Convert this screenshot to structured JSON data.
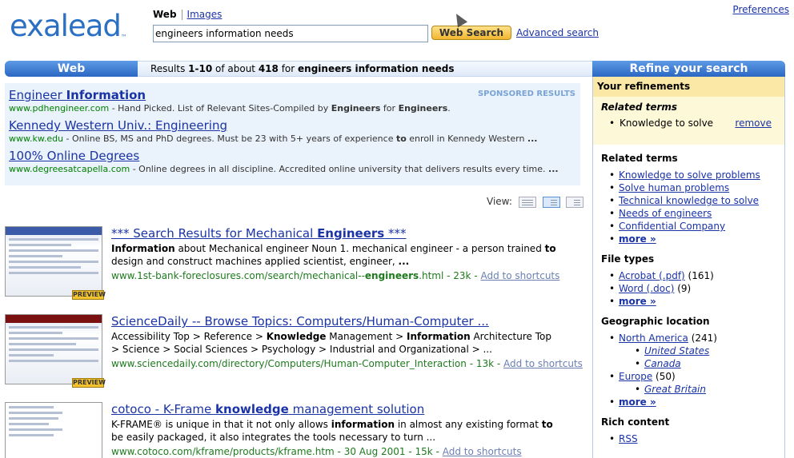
{
  "header": {
    "logo": "exalead",
    "logo_tm": "™",
    "tab_web": "Web",
    "tab_images": "Images",
    "search_value": "engineers information needs",
    "search_button": "Web Search",
    "advanced_search": "Advanced search",
    "preferences": "Preferences"
  },
  "bar": {
    "left_label": "Web",
    "results_prefix": "Results ",
    "results_range": "1-10",
    "results_mid": " of about ",
    "results_count": "418",
    "results_for": " for ",
    "results_query": "engineers information needs",
    "right_label": "Refine your search"
  },
  "sponsored": {
    "label": "SPONSORED RESULTS",
    "items": [
      {
        "title_a": "Engineer ",
        "title_b": "Information",
        "url": "www.pdhengineer.com",
        "desc_a": " - Hand Picked. List of Relevant Sites-Compiled by ",
        "desc_b": "Engineers",
        "desc_c": " for ",
        "desc_d": "Engineers",
        "desc_e": "."
      },
      {
        "title_a": "Kennedy Western Univ.: Engineering",
        "url": "www.kw.edu",
        "desc_a": " - Online BS, MS and PhD degrees. Must be 23 with 5+ years of experience ",
        "desc_b": "to",
        "desc_c": " enroll in Kennedy Western ",
        "desc_d": "...",
        "desc_e": ""
      },
      {
        "title_a": "100% Online Degrees",
        "url": "www.degreesatcapella.com",
        "desc_a": " - Online degrees in all discipline. Accredited online university that delivers results every time. ",
        "desc_b": "...",
        "desc_c": "",
        "desc_d": "",
        "desc_e": ""
      }
    ]
  },
  "view_label": "View:",
  "results": [
    {
      "title_a": "*** Search Results for Mechanical ",
      "title_b": "Engineers",
      "title_c": " ***",
      "snippet_a": "Information",
      "snippet_b": " about Mechanical engineer Noun 1. mechanical engineer - a person trained ",
      "snippet_c": "to",
      "snippet_d": " design and construct machines applied scientist, engineer, ",
      "snippet_e": "...",
      "url_a": "www.1st-bank-foreclosures.com/search/mechanical--",
      "url_b": "engineers",
      "url_c": ".html",
      "size": " - 23k - ",
      "shortcut": "Add to shortcuts",
      "preview": "PREVIEW"
    },
    {
      "title_a": "ScienceDaily -- Browse Topics: Computers/Human-Computer ...",
      "title_b": "",
      "title_c": "",
      "snippet_a": "Accessibility Top > Reference > ",
      "snippet_b": "Knowledge",
      "snippet_c": " Management > ",
      "snippet_d": "Information",
      "snippet_e": " Architecture Top > Science > Social Sciences > Psychology > Industrial and Organizational > ...",
      "url_a": "www.sciencedaily.com/directory/Computers/Human-Computer_Interaction",
      "url_b": "",
      "url_c": "",
      "size": " - 13k - ",
      "shortcut": "Add to shortcuts",
      "preview": "PREVIEW"
    },
    {
      "title_a": "cotoco - K-Frame ",
      "title_b": "knowledge",
      "title_c": " management solution",
      "snippet_a": "K-FRAME® is unique in that it not only allows ",
      "snippet_b": "information",
      "snippet_c": " in almost any existing format ",
      "snippet_d": "to",
      "snippet_e": " be easily packaged, it also integrates the tools necessary to turn ...",
      "url_a": "www.cotoco.com/kframe/products/kframe.htm",
      "url_b": "",
      "url_c": "",
      "size": " - 30 Aug 2001 - 15k - ",
      "shortcut": "Add to shortcuts",
      "preview": ""
    }
  ],
  "refine": {
    "your_refinements": "Your refinements",
    "related_terms_title": "Related terms",
    "current_term": "Knowledge to solve",
    "remove": "remove",
    "related_terms_heading": "Related terms",
    "related_terms": [
      "Knowledge to solve problems",
      "Solve human problems",
      "Technical knowledge to solve",
      "Needs of engineers",
      "Confidential Company"
    ],
    "more": "more »",
    "file_types_heading": "File types",
    "file_types": [
      {
        "label": "Acrobat (.pdf)",
        "count": " (161)"
      },
      {
        "label": "Word (.doc)",
        "count": " (9)"
      }
    ],
    "geo_heading": "Geographic location",
    "geo": {
      "na": "North America",
      "na_count": " (241)",
      "us": "United States",
      "ca": "Canada",
      "eu": "Europe",
      "eu_count": " (50)",
      "gb": "Great Britain"
    },
    "rich_heading": "Rich content",
    "rss": "RSS"
  }
}
